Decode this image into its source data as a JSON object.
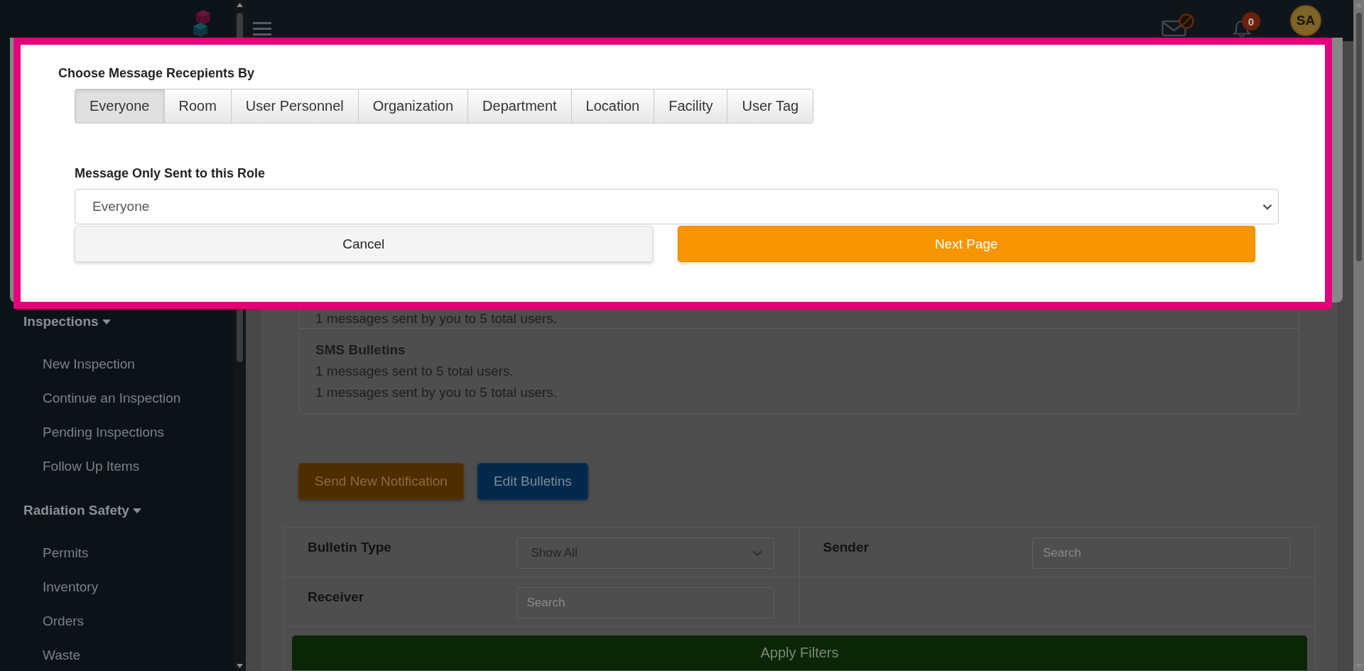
{
  "sidebar": {
    "sections": [
      {
        "label": "Inspections",
        "expanded": true,
        "items": [
          "New Inspection",
          "Continue an Inspection",
          "Pending Inspections",
          "Follow Up Items"
        ]
      },
      {
        "label": "Radiation Safety",
        "expanded": true,
        "items": [
          "Permits",
          "Inventory",
          "Orders",
          "Waste"
        ]
      }
    ]
  },
  "top_bar": {
    "notification_count": "0",
    "avatar_initials": "SA"
  },
  "dialog": {
    "title": "Choose Message Recepients By",
    "tabs": [
      {
        "label": "Everyone",
        "selected": true
      },
      {
        "label": "Room",
        "selected": false
      },
      {
        "label": "User Personnel",
        "selected": false
      },
      {
        "label": "Organization",
        "selected": false
      },
      {
        "label": "Department",
        "selected": false
      },
      {
        "label": "Location",
        "selected": false
      },
      {
        "label": "Facility",
        "selected": false
      },
      {
        "label": "User Tag",
        "selected": false
      }
    ],
    "role_label": "Message Only Sent to this Role",
    "role_select": {
      "value": "Everyone"
    },
    "buttons": [
      {
        "label": "Cancel",
        "kind": "secondary"
      },
      {
        "label": "Next Page",
        "kind": "primary"
      }
    ]
  },
  "main": {
    "summary": [
      {
        "lines": [
          "1 messages sent by you to 5 total users."
        ]
      },
      {
        "title": "SMS Bulletins",
        "lines": [
          "1 messages sent to 5 total users.",
          "1 messages sent by you to 5 total users."
        ]
      }
    ],
    "actions": [
      {
        "label": "Send New Notification",
        "kind": "warning"
      },
      {
        "label": "Edit Bulletins",
        "kind": "info"
      }
    ],
    "filters": [
      {
        "label": "Bulletin Type",
        "kind": "select",
        "value": "Show All"
      },
      {
        "label": "Sender",
        "kind": "search",
        "placeholder": "Search"
      },
      {
        "label": "Receiver",
        "kind": "search",
        "placeholder": "Search"
      }
    ],
    "apply_button": {
      "label": "Apply Filters"
    }
  }
}
